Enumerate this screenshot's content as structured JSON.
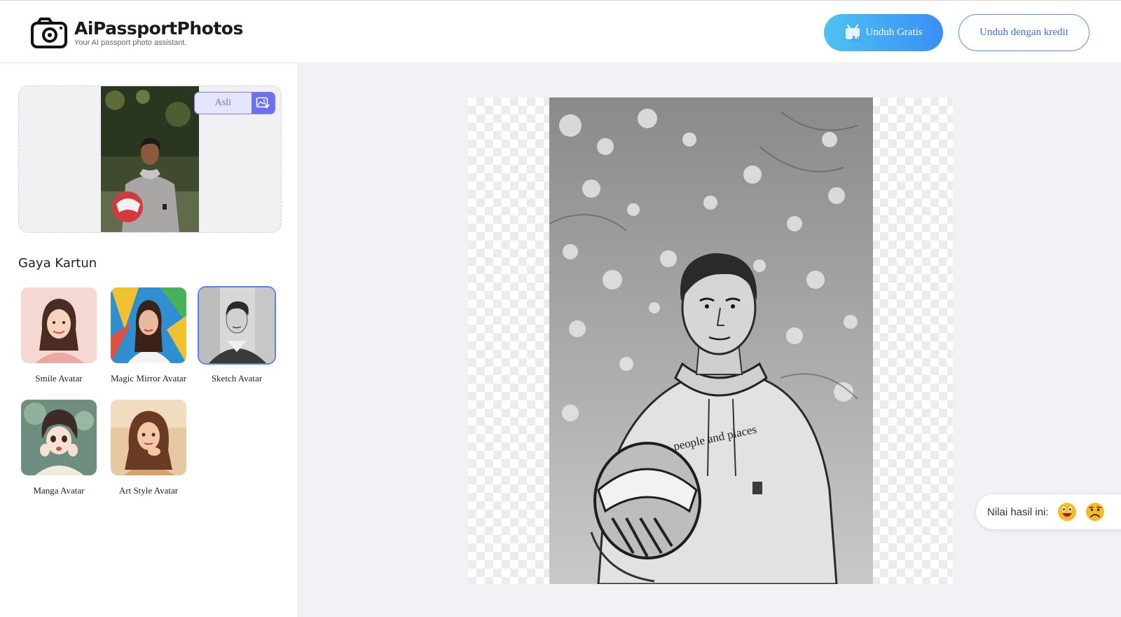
{
  "header": {
    "app_title": "AiPassportPhotos",
    "app_subtitle": "Your AI passport photo assistant.",
    "free_download_label": "Unduh Gratis",
    "credit_download_label": "Unduh dengan kredit"
  },
  "sidebar": {
    "original_toggle_label": "Asli",
    "section_title": "Gaya Kartun",
    "styles": [
      {
        "label": "Smile Avatar",
        "selected": false
      },
      {
        "label": "Magic Mirror Avatar",
        "selected": false
      },
      {
        "label": "Sketch Avatar",
        "selected": true
      },
      {
        "label": "Manga Avatar",
        "selected": false
      },
      {
        "label": "Art Style Avatar",
        "selected": false
      }
    ]
  },
  "main": {
    "photo_text": "people and places"
  },
  "rating": {
    "label": "Nilai hasil ini:",
    "options": [
      "happy-emoji",
      "sad-emoji"
    ]
  },
  "colors": {
    "accent": "#3a8ef4",
    "accent_light": "#4dc3f2",
    "toggle_purple": "#6f6ff0",
    "selected_border": "#5b7ef0",
    "main_bg": "#f1f2f6"
  }
}
